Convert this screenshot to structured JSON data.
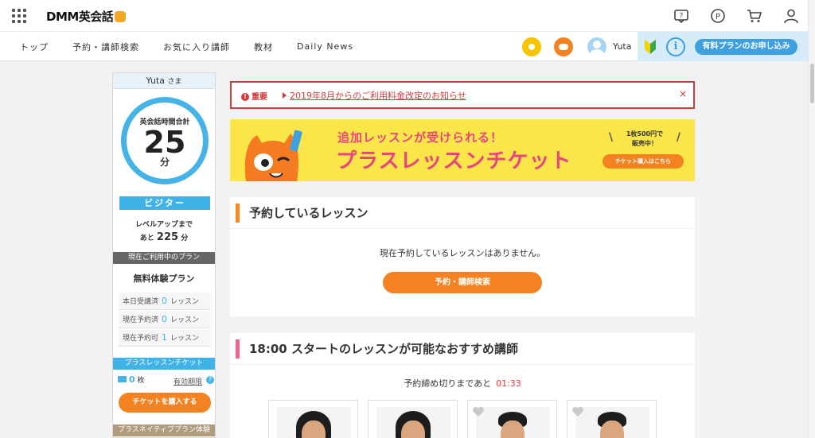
{
  "header": {
    "logo_text": "DMM英会話",
    "icons": [
      "help-icon",
      "point-icon",
      "cart-icon",
      "user-icon"
    ]
  },
  "nav": {
    "items": [
      "トップ",
      "予約・講師検索",
      "お気に入り講師",
      "教材",
      "Daily News"
    ],
    "user_name": "Yuta",
    "plan_button": "有料プランのお申し込み",
    "info_glyph": "i"
  },
  "sidebar": {
    "user_label": "Yuta",
    "user_suffix": "さま",
    "total_label": "英会話時間合計",
    "total_value": "25",
    "total_unit": "分",
    "level": "ビジター",
    "levelup_label": "レベルアップまで",
    "levelup_prefix": "あと",
    "levelup_value": "225",
    "levelup_unit": "分",
    "current_plan_title": "現在ご利用中のプラン",
    "plan_name": "無料体験プラン",
    "stats": [
      {
        "label": "本日受講済",
        "value": "0",
        "unit": "レッスン"
      },
      {
        "label": "現在予約済",
        "value": "0",
        "unit": "レッスン"
      },
      {
        "label": "現在予約可",
        "value": "1",
        "unit": "レッスン"
      }
    ],
    "ticket_title": "プラスレッスンチケット",
    "ticket_count": "0",
    "ticket_unit": "枚",
    "ticket_expiry": "有効期限",
    "ticket_help": "?",
    "buy_button": "チケットを購入する",
    "native_title": "プラスネイティブプラン体験"
  },
  "notice": {
    "tag": "重要",
    "link": "2019年8月からのご利用料金改定のお知らせ",
    "close": "×"
  },
  "banner": {
    "sub": "追加レッスンが受けられる！",
    "main": "プラスレッスンチケット",
    "price_line1": "1枚500円で",
    "price_line2": "販売中！",
    "button": "チケット購入はこちら"
  },
  "reserved": {
    "title": "予約しているレッスン",
    "empty": "現在予約しているレッスンはありません。",
    "button": "予約・講師検索"
  },
  "recommend": {
    "title": "18:00 スタートのレッスンが可能なおすすめ講師",
    "deadline_label": "予約締め切りまであと",
    "deadline_time": "01:33"
  },
  "colors": {
    "accent_orange": "#f58220",
    "accent_blue": "#3fb3e8",
    "alert_red": "#cf3a3a",
    "banner_yellow": "#fbe64a",
    "banner_pink": "#e8457f"
  }
}
